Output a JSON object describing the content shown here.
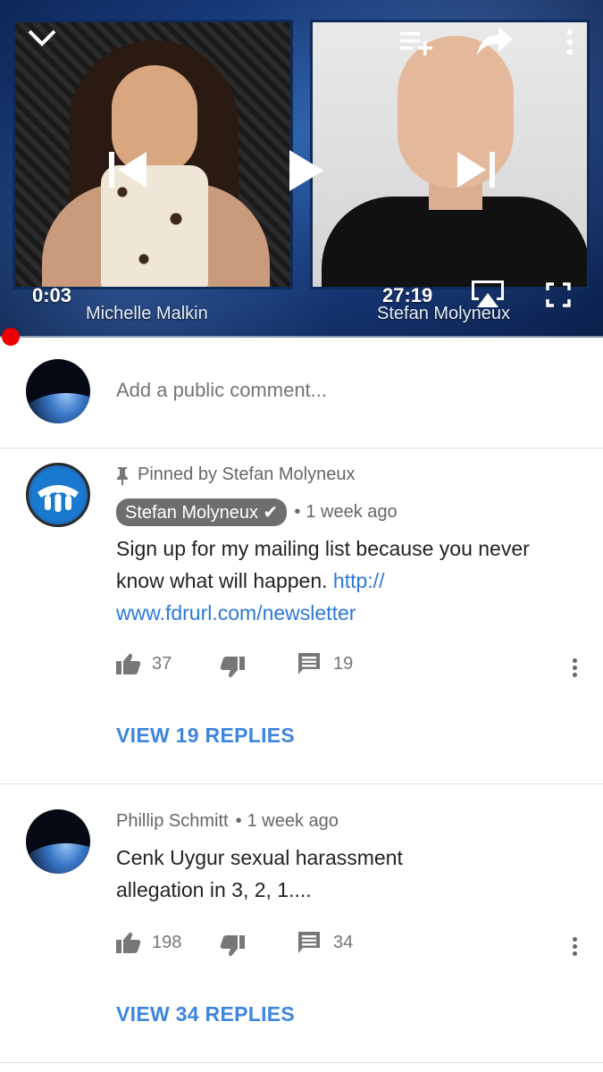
{
  "player": {
    "current_time": "0:03",
    "duration": "27:19",
    "left_name": "Michelle Malkin",
    "right_name": "Stefan Molyneux",
    "progress_fraction": 0.002,
    "icons": [
      "chevron-down-icon",
      "add-to-playlist-icon",
      "share-icon",
      "more-vert-icon",
      "previous-icon",
      "play-icon",
      "next-icon",
      "airplay-icon",
      "fullscreen-icon"
    ]
  },
  "compose": {
    "placeholder": "Add a public comment..."
  },
  "comments": [
    {
      "pinned_label": "Pinned by Stefan Molyneux",
      "author": "Stefan Molyneux",
      "verified": true,
      "time": "1 week ago",
      "text_before_link": "Sign up for my mailing list because you never know what will happen.",
      "link_part1": "http://",
      "link_part2": "www.fdrurl.com/newsletter",
      "likes": "37",
      "replies_count": "19",
      "view_replies": "VIEW 19 REPLIES"
    },
    {
      "author": "Phillip Schmitt",
      "time": "1 week ago",
      "text_line1": "Cenk Uygur sexual harassment",
      "text_line2": "allegation in 3, 2, 1....",
      "likes": "198",
      "replies_count": "34",
      "view_replies": "VIEW 34 REPLIES"
    }
  ],
  "colors": {
    "accent_red": "#ee0000",
    "link_blue": "#2b79d8",
    "reply_blue": "#3d86dc"
  }
}
